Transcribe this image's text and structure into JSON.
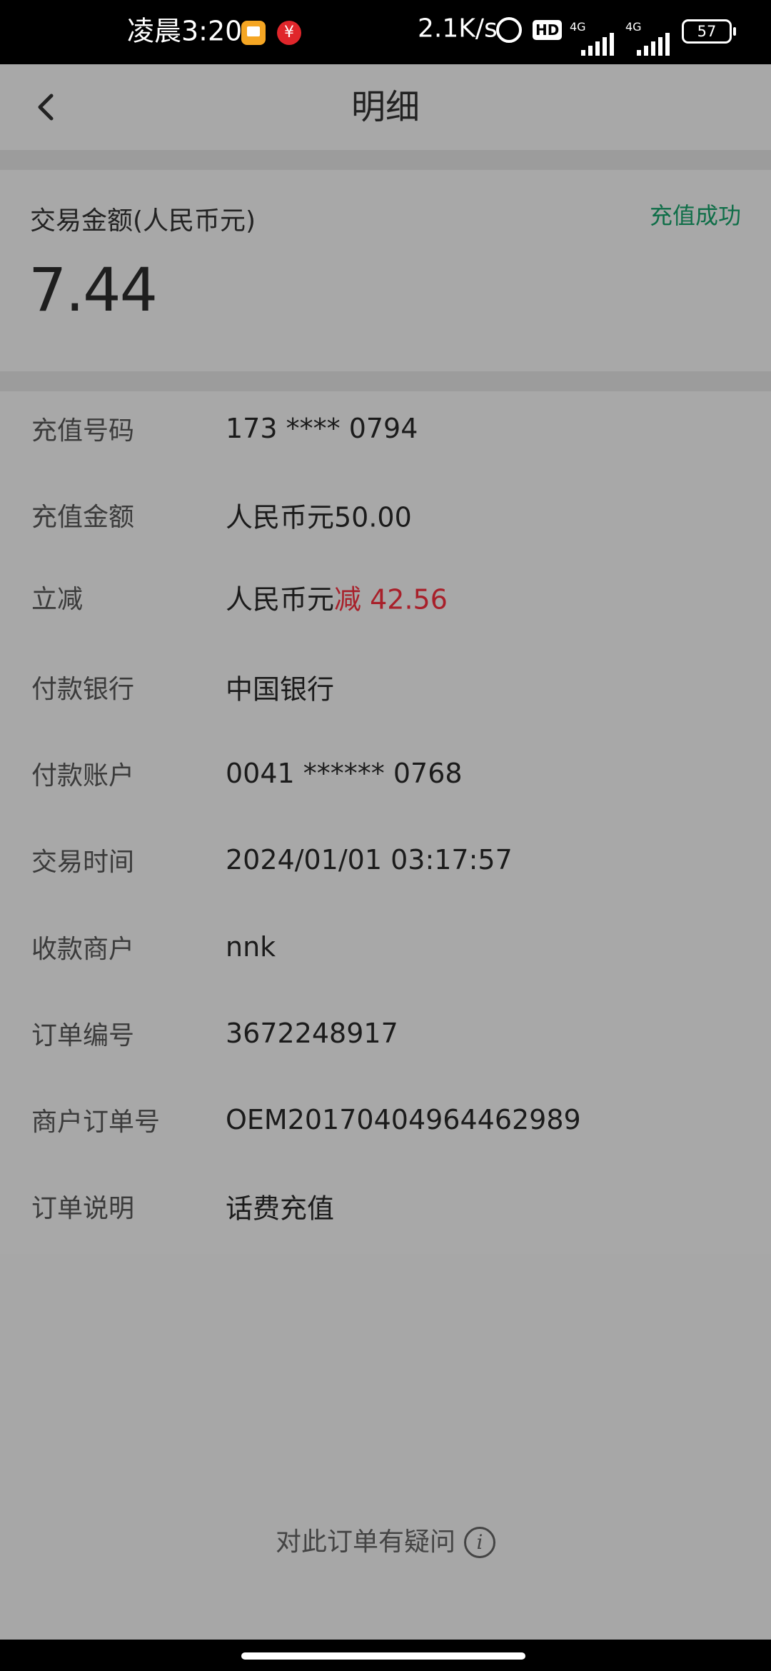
{
  "status_bar": {
    "time": "凌晨3:20",
    "net_speed": "2.1K/s",
    "hd_label": "HD",
    "sim1_label": "4G",
    "sim2_label": "4G",
    "battery": "57"
  },
  "header": {
    "title": "明细"
  },
  "summary": {
    "amount_label": "交易金额(人民币元)",
    "status": "充值成功",
    "amount": "7.44"
  },
  "details": [
    {
      "label": "充值号码",
      "value": "173 **** 0794"
    },
    {
      "label": "充值金额",
      "value": "人民币元50.00"
    },
    {
      "label": "立减",
      "value_prefix": "人民币元",
      "value_highlight": "减 42.56"
    },
    {
      "label": "付款银行",
      "value": "中国银行"
    },
    {
      "label": "付款账户",
      "value": "0041 ****** 0768"
    },
    {
      "label": "交易时间",
      "value": "2024/01/01 03:17:57"
    },
    {
      "label": "收款商户",
      "value": "nnk"
    },
    {
      "label": "订单编号",
      "value": "3672248917"
    },
    {
      "label": "商户订单号",
      "value": "OEM20170404964462989"
    },
    {
      "label": "订单说明",
      "value": "话费充值"
    }
  ],
  "footer": {
    "question_link": "对此订单有疑问",
    "info_glyph": "i"
  },
  "colors": {
    "status_green": "#0f6e48",
    "discount_red": "#a8202a"
  }
}
